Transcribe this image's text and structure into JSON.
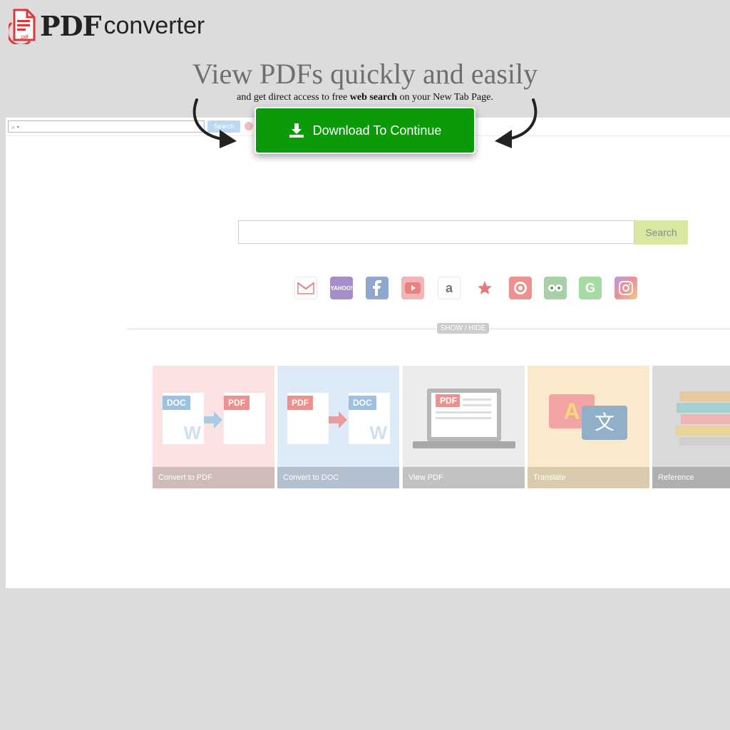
{
  "logo": {
    "pdf": "PDF",
    "converter": "converter",
    "icon_tag": ".pdf"
  },
  "headline": "View PDFs quickly and easily",
  "subline": {
    "pre": "and get direct access to free ",
    "bold": "web search",
    "post": " on your New Tab Page."
  },
  "cta": {
    "label": "Download To Continue",
    "color": "#0a9a0a"
  },
  "browser": {
    "toolbar_search_placeholder": "⌕ ▾",
    "toolbar_search_button": "Search",
    "main_search_button": "Search",
    "show_hide": "SHOW / HIDE",
    "quick_links": [
      "gmail-icon",
      "yahoo-icon",
      "facebook-icon",
      "youtube-icon",
      "amazon-icon",
      "macys-icon",
      "target-icon",
      "tripadvisor-icon",
      "grammarly-icon",
      "instagram-icon"
    ],
    "quick_link_text": {
      "yahoo": "YAHOO!",
      "amazon": "a",
      "grammarly": "G"
    },
    "tiles": [
      {
        "label": "Convert to PDF",
        "color": "#fbe3e3"
      },
      {
        "label": "Convert to DOC",
        "color": "#dcebf7"
      },
      {
        "label": "View PDF",
        "color": "#ececec"
      },
      {
        "label": "Translate",
        "color": "#fbe9cc"
      },
      {
        "label": "Reference",
        "color": "#dadada"
      }
    ],
    "doc_tags": {
      "doc": "DOC",
      "pdf": "PDF",
      "w": "W"
    },
    "translate_glyphs": {
      "a": "A",
      "zh": "文"
    }
  }
}
